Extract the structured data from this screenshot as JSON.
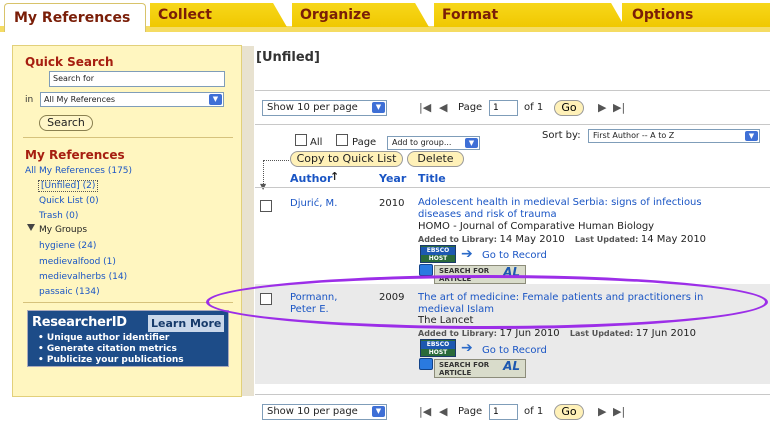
{
  "tabs": [
    "My References",
    "Collect",
    "Organize",
    "Format",
    "Options"
  ],
  "sidebar": {
    "quick_search": {
      "heading": "Quick Search",
      "input_value": "Search for",
      "in_label": "in",
      "select_value": "All My References",
      "button": "Search"
    },
    "my_references": {
      "heading": "My References",
      "all": "All My References (175)",
      "unfiled": "[Unfiled] (2)",
      "quick_list": "Quick List (0)",
      "trash": "Trash (0)",
      "my_groups": "My Groups",
      "groups": [
        "hygiene (24)",
        "medievalfood (1)",
        "medievalherbs (14)",
        "passaic (134)"
      ]
    },
    "researcher_id": {
      "title": "ResearcherID",
      "learn_more": "Learn More",
      "bullets": [
        "Unique author identifier",
        "Generate citation metrics",
        "Publicize your publications"
      ]
    }
  },
  "main": {
    "title": "[Unfiled]",
    "pager_top": {
      "show": "Show 10 per page",
      "page_label": "Page",
      "page_value": "1",
      "of": "of 1",
      "go": "Go"
    },
    "pager_bottom": {
      "show": "Show 10 per page",
      "page_label": "Page",
      "page_value": "1",
      "of": "of 1",
      "go": "Go"
    },
    "select_all": "All",
    "select_page": "Page",
    "add_to_group": "Add to group...",
    "sort_label": "Sort by:",
    "sort_value": "First Author -- A to Z",
    "copy_btn": "Copy to Quick List",
    "delete_btn": "Delete",
    "columns": {
      "author": "Author",
      "year": "Year",
      "title": "Title"
    },
    "rows": [
      {
        "author_line1": "Djurić, M.",
        "author_line2": "",
        "year": "2010",
        "title_line1": "Adolescent health in medieval Serbia: signs of infectious",
        "title_line2": "diseases and risk of trauma",
        "journal": "HOMO - Journal of Comparative Human Biology",
        "added_label": "Added to Library:",
        "added_value": "14 May 2010",
        "updated_label": "Last Updated:",
        "updated_value": "14 May 2010",
        "goto": "Go to Record"
      },
      {
        "author_line1": "Pormann,",
        "author_line2": "Peter E.",
        "year": "2009",
        "title_line1": "The art of medicine: Female patients and practitioners in",
        "title_line2": "medieval Islam",
        "journal": "The Lancet",
        "added_label": "Added to Library:",
        "added_value": "17 Jun 2010",
        "updated_label": "Last Updated:",
        "updated_value": "17 Jun 2010",
        "goto": "Go to Record"
      }
    ],
    "ebsco_top": "EBSCO",
    "ebsco_bottom": "HOST",
    "search_article_1": "SEARCH FOR",
    "search_article_2": "ARTICLE",
    "search_article_logo": "AL"
  },
  "colors": {
    "tab_yellow": "#f7d71b",
    "tab_text": "#7a1e08",
    "link_blue": "#1a55c4",
    "oval_purple": "#9c2ee8"
  }
}
